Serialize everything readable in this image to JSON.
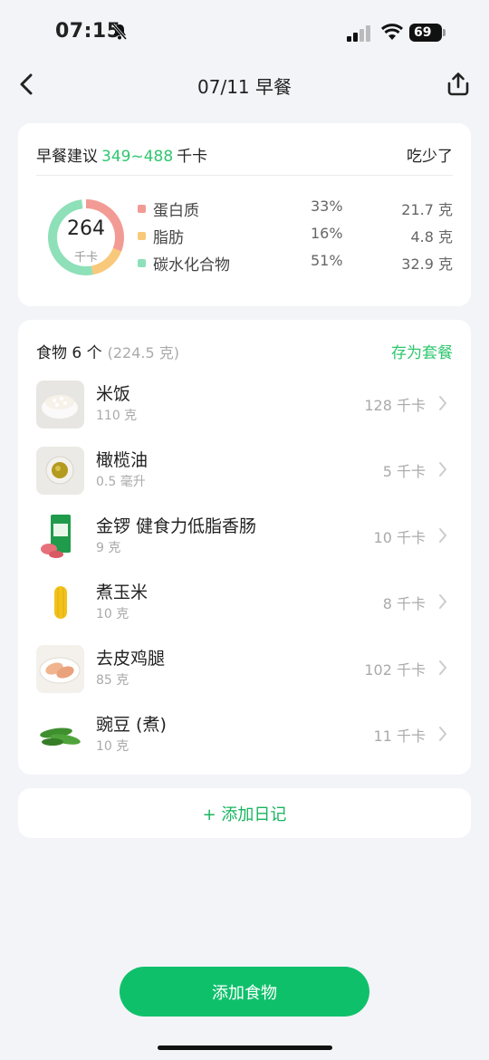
{
  "status_bar": {
    "time": "07:15",
    "battery": "69"
  },
  "nav": {
    "title": "07/11 早餐"
  },
  "summary": {
    "suggest_label": "早餐建议",
    "suggest_range": "349~488",
    "suggest_unit": "千卡",
    "status": "吃少了",
    "total_kcal": "264",
    "kcal_unit": "千卡",
    "macros": [
      {
        "name": "蛋白质",
        "percent": "33%",
        "amount": "21.7 克",
        "color": "#f29b94",
        "fraction": 0.33
      },
      {
        "name": "脂肪",
        "percent": "16%",
        "amount": "4.8 克",
        "color": "#f8c97a",
        "fraction": 0.16
      },
      {
        "name": "碳水化合物",
        "percent": "51%",
        "amount": "32.9 克",
        "color": "#8ee0b8",
        "fraction": 0.51
      }
    ]
  },
  "food_list": {
    "title": "食物 6 个",
    "total_weight": "(224.5 克)",
    "save_label": "存为套餐",
    "items": [
      {
        "name": "米饭",
        "amount": "110 克",
        "kcal": "128 千卡",
        "icon": "rice-bowl-icon"
      },
      {
        "name": "橄榄油",
        "amount": "0.5 毫升",
        "kcal": "5 千卡",
        "icon": "olive-oil-icon"
      },
      {
        "name": "金锣 健食力低脂香肠",
        "amount": "9 克",
        "kcal": "10 千卡",
        "icon": "sausage-package-icon"
      },
      {
        "name": "煮玉米",
        "amount": "10 克",
        "kcal": "8 千卡",
        "icon": "corn-icon"
      },
      {
        "name": "去皮鸡腿",
        "amount": "85 克",
        "kcal": "102 千卡",
        "icon": "chicken-leg-icon"
      },
      {
        "name": "豌豆 (煮)",
        "amount": "10 克",
        "kcal": "11 千卡",
        "icon": "pea-pod-icon"
      }
    ]
  },
  "diary_button": "+ 添加日记",
  "add_food_button": "添加食物",
  "colors": {
    "accent": "#0fc06b",
    "accent_text": "#2fc76f"
  }
}
